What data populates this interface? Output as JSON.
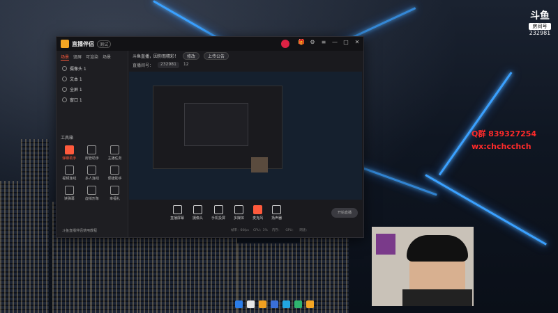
{
  "app": {
    "title": "直播伴侣",
    "version": "测试",
    "left_tabs": [
      "场景",
      "竖屏",
      "可渲染",
      "场景"
    ],
    "sources": [
      "摄像头 1",
      "文本 1",
      "全屏 1",
      "窗口 1"
    ],
    "toolbox_label": "工具箱",
    "tools": [
      "弹幕助手",
      "房管助手",
      "主播任务",
      "视频连线",
      "多人连线",
      "便捷助手",
      "读弹幕",
      "虚拟形象",
      "幸福礼"
    ],
    "footer_text": "斗鱼直播伴侣使用教程",
    "topbar": {
      "notice": "斗鱼直播，因你而精彩！",
      "btn_category": "修改",
      "btn_title": "上传公告"
    },
    "subbar": {
      "room_label": "直播间号：",
      "room_value": "232981",
      "count": "12"
    },
    "bottom_tools": [
      "直播屏幕",
      "摄像头",
      "手机投屏",
      "多媒体",
      "麦克风",
      "扬声器"
    ],
    "start_label": "开始直播",
    "stats": [
      "帧率：60fps",
      "CPU：3%",
      "内存：",
      "GPU：",
      "网速："
    ]
  },
  "overlay": {
    "qq": "Q群 839327254",
    "wx": "wx:chchcchch",
    "brand_top": "斗鱼",
    "brand_mid": "房间号",
    "room_no": "232981"
  },
  "colors": {
    "accent": "#ff5a3c",
    "neon": "#3aa0ff",
    "overlay_text": "#ff2a2a"
  }
}
